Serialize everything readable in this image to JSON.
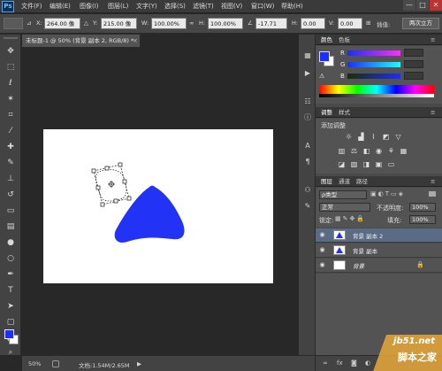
{
  "app": {
    "logo": "Ps"
  },
  "menu": [
    "文件(F)",
    "编辑(E)",
    "图像(I)",
    "图层(L)",
    "文字(Y)",
    "选择(S)",
    "滤镜(T)",
    "视图(V)",
    "窗口(W)",
    "帮助(H)"
  ],
  "window_buttons": [
    "—",
    "□",
    "✕"
  ],
  "options": {
    "x_label": "X:",
    "x_value": "264.00 像",
    "y_label": "Y:",
    "y_value": "215.00 像",
    "w_label": "W:",
    "w_value": "100.00%",
    "h_label": "H:",
    "h_value": "100.00%",
    "angle_value": "-17.71",
    "h2_label": "H:",
    "h2_value": "0.00",
    "v_label": "V:",
    "v_value": "0.00",
    "interp_label": "插值:",
    "panel_btn": "两次立方"
  },
  "document": {
    "tab_title": "未标题-1 @ 50% (背景 副本 2, RGB/8) *",
    "close": "×"
  },
  "status": {
    "zoom": "50%",
    "doc_info": "文档:1.54M/2.65M"
  },
  "color_panel": {
    "tabs": [
      "颜色",
      "色板"
    ],
    "labels": [
      "R",
      "G",
      "B"
    ],
    "values": [
      "",
      "",
      ""
    ]
  },
  "adjust_panel": {
    "tabs": [
      "调整",
      "样式"
    ],
    "title": "添加调整"
  },
  "layers_panel": {
    "tabs": [
      "图层",
      "通道",
      "路径"
    ],
    "kind_label": "ρ类型",
    "blend_mode": "正常",
    "opacity_label": "不透明度:",
    "opacity_value": "100%",
    "lock_label": "锁定:",
    "fill_label": "填充:",
    "fill_value": "100%",
    "layers": [
      {
        "name": "背景 副本 2",
        "selected": true
      },
      {
        "name": "背景 副本",
        "selected": false
      },
      {
        "name": "背景",
        "selected": false,
        "locked": true
      }
    ],
    "footer_icons": [
      "link-icon",
      "fx-icon",
      "mask-icon",
      "adjustment-icon",
      "folder-icon",
      "new-layer-icon",
      "trash-icon"
    ]
  },
  "colors": {
    "foreground": "#1a2eff",
    "background": "#ffffff",
    "shape": "#2233f5"
  },
  "watermark": {
    "line1": "jb51.net",
    "line2": "脚本之家"
  }
}
